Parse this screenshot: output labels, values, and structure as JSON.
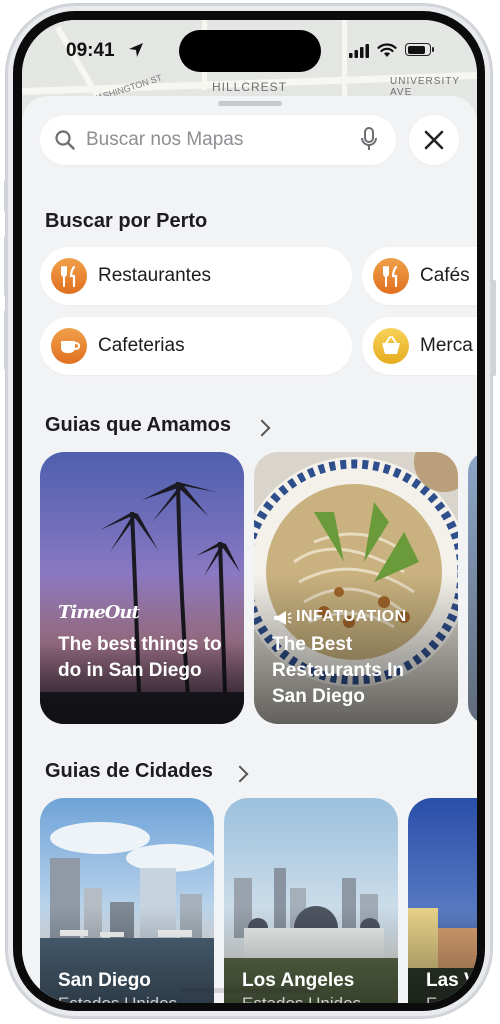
{
  "status_bar": {
    "time": "09:41"
  },
  "map": {
    "street_1": "HILLCREST",
    "street_2": "UNIVERSITY AVE",
    "street_3": "WASHINGTON ST"
  },
  "search": {
    "placeholder": "Buscar nos Mapas"
  },
  "nearby": {
    "title": "Buscar por Perto",
    "chips": [
      {
        "label": "Restaurantes",
        "icon": "fork-knife-icon"
      },
      {
        "label": "Cafés",
        "icon": "fork-knife-icon"
      },
      {
        "label": "Cafeterias",
        "icon": "coffee-cup-icon"
      },
      {
        "label": "Merca",
        "icon": "basket-icon"
      }
    ]
  },
  "guides": {
    "title": "Guias que Amamos",
    "cards": [
      {
        "brand": "TimeOut",
        "title": "The best things to do in San Diego"
      },
      {
        "brand": "INFATUATION",
        "title": "The Best Restaurants In San Diego"
      }
    ]
  },
  "city_guides": {
    "title": "Guias de Cidades",
    "cards": [
      {
        "city": "San Diego",
        "country": "Estados Unidos"
      },
      {
        "city": "Los Angeles",
        "country": "Estados Unidos"
      },
      {
        "city": "Las V",
        "country": "Esta"
      }
    ]
  },
  "colors": {
    "accent_orange": "#e87a2a",
    "accent_yellow": "#eec13a",
    "sheet": "#f2f3f5"
  }
}
